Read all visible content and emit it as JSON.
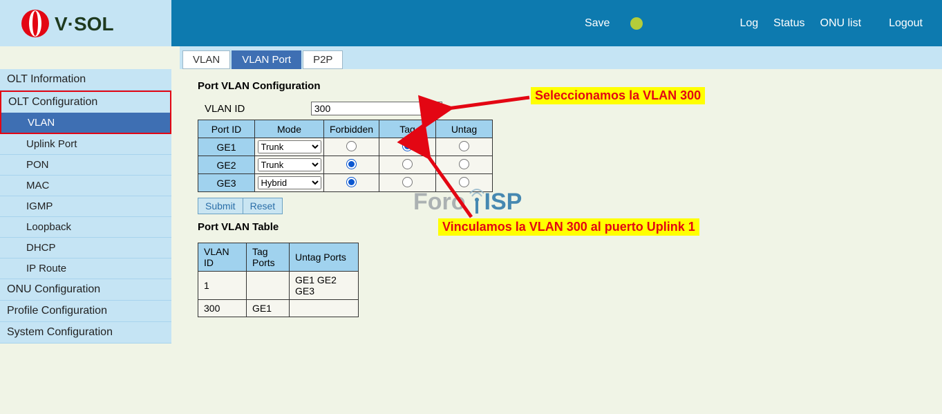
{
  "brand": "V·SOL",
  "topbar": {
    "save": "Save",
    "log": "Log",
    "status": "Status",
    "onu_list": "ONU list",
    "logout": "Logout"
  },
  "sidebar": {
    "items": [
      {
        "label": "OLT Information",
        "sub": false
      },
      {
        "label": "OLT Configuration",
        "sub": false,
        "highlight": "top"
      },
      {
        "label": "VLAN",
        "sub": true,
        "active": true,
        "highlight": "bottom"
      },
      {
        "label": "Uplink Port",
        "sub": true
      },
      {
        "label": "PON",
        "sub": true
      },
      {
        "label": "MAC",
        "sub": true
      },
      {
        "label": "IGMP",
        "sub": true
      },
      {
        "label": "Loopback",
        "sub": true
      },
      {
        "label": "DHCP",
        "sub": true
      },
      {
        "label": "IP Route",
        "sub": true
      },
      {
        "label": "ONU Configuration",
        "sub": false
      },
      {
        "label": "Profile Configuration",
        "sub": false
      },
      {
        "label": "System Configuration",
        "sub": false
      }
    ]
  },
  "tabs": [
    {
      "label": "VLAN"
    },
    {
      "label": "VLAN Port",
      "active": true
    },
    {
      "label": "P2P"
    }
  ],
  "section1_title": "Port VLAN Configuration",
  "vlan_id_label": "VLAN ID",
  "vlan_id_value": "300",
  "cfg_headers": {
    "port": "Port ID",
    "mode": "Mode",
    "forbidden": "Forbidden",
    "tag": "Tag",
    "untag": "Untag"
  },
  "cfg_rows": [
    {
      "port": "GE1",
      "mode": "Trunk",
      "sel": "tag"
    },
    {
      "port": "GE2",
      "mode": "Trunk",
      "sel": "forbidden"
    },
    {
      "port": "GE3",
      "mode": "Hybrid",
      "sel": "forbidden"
    }
  ],
  "btn_submit": "Submit",
  "btn_reset": "Reset",
  "section2_title": "Port VLAN Table",
  "vtab_headers": {
    "id": "VLAN ID",
    "tag": "Tag Ports",
    "untag": "Untag Ports"
  },
  "vtab_rows": [
    {
      "id": "1",
      "tag": "",
      "untag": "GE1 GE2 GE3"
    },
    {
      "id": "300",
      "tag": "GE1",
      "untag": ""
    }
  ],
  "annotations": {
    "a1": "Seleccionamos la VLAN 300",
    "a2": "Vinculamos la VLAN 300 al puerto Uplink 1"
  },
  "watermark": {
    "foro": "Foro",
    "isp": "ISP"
  }
}
